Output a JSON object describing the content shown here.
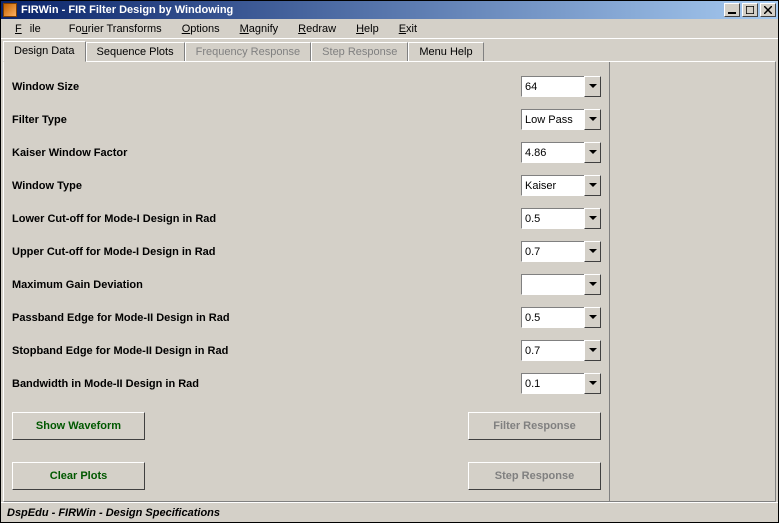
{
  "title": "FIRWin - FIR Filter Design by Windowing",
  "menu": [
    "File",
    "Fourier Transforms",
    "Options",
    "Magnify",
    "Redraw",
    "Help",
    "Exit"
  ],
  "tabs": [
    {
      "label": "Design Data",
      "active": true,
      "disabled": false
    },
    {
      "label": "Sequence Plots",
      "active": false,
      "disabled": false
    },
    {
      "label": "Frequency Response",
      "active": false,
      "disabled": true
    },
    {
      "label": "Step Response",
      "active": false,
      "disabled": true
    },
    {
      "label": "Menu Help",
      "active": false,
      "disabled": false
    }
  ],
  "fields": [
    {
      "label": "Window Size",
      "value": "64"
    },
    {
      "label": "Filter Type",
      "value": "Low Pass"
    },
    {
      "label": "Kaiser Window Factor",
      "value": "4.86"
    },
    {
      "label": "Window Type",
      "value": "Kaiser"
    },
    {
      "label": "Lower Cut-off for Mode-I Design in Rad",
      "value": "0.5"
    },
    {
      "label": "Upper Cut-off for Mode-I Design in Rad",
      "value": "0.7"
    },
    {
      "label": "Maximum Gain Deviation",
      "value": ""
    },
    {
      "label": "Passband Edge for Mode-II Design in Rad",
      "value": "0.5"
    },
    {
      "label": "Stopband Edge for Mode-II Design in Rad",
      "value": "0.7"
    },
    {
      "label": "Bandwidth in Mode-II Design in Rad",
      "value": "0.1"
    }
  ],
  "buttons": {
    "showWaveform": "Show Waveform",
    "filterResponse": "Filter Response",
    "clearPlots": "Clear Plots",
    "stepResponse": "Step Response"
  },
  "status": "DspEdu - FIRWin - Design Specifications"
}
